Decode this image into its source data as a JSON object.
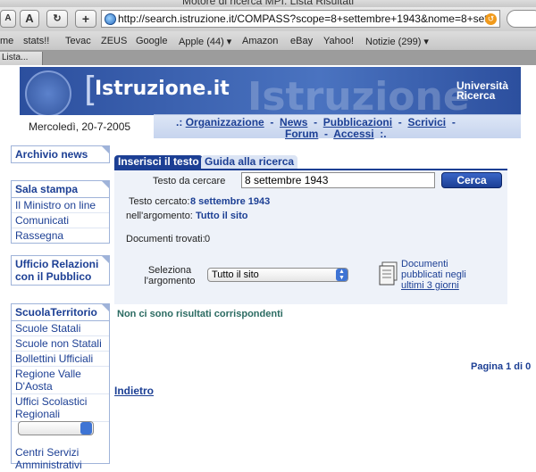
{
  "browser": {
    "window_title": "Motore di ricerca MPI: Lista Risultati",
    "url": "http://search.istruzione.it/COMPASS?scope=8+settembre+1943&nome=8+set",
    "bookmarks": [
      "me",
      "stats!!",
      "Tevac",
      "ZEUS",
      "Google",
      "Apple (44) ▾",
      "Amazon",
      "eBay",
      "Yahoo!",
      "Notizie (299) ▾"
    ],
    "tab_label": "Lista..."
  },
  "header": {
    "site_title": "Istruzione.it",
    "watermark": "Istruzione",
    "ministry_line1": "Università",
    "ministry_line2": "Ricerca",
    "date": "Mercoledì, 20-7-2005"
  },
  "nav": {
    "prefix": ".:",
    "items": [
      "Organizzazione",
      "News",
      "Pubblicazioni",
      "Scrivici",
      "Forum",
      "Accessi"
    ],
    "separator": "-",
    "suffix": ":."
  },
  "sidebar": {
    "archivio": "Archivio news",
    "sala_stampa": {
      "title": "Sala stampa",
      "items": [
        "Il Ministro on line",
        "Comunicati",
        "Rassegna"
      ]
    },
    "urp": "Ufficio Relazioni con il Pubblico",
    "scuola_territorio": {
      "title": "ScuolaTerritorio",
      "items": [
        "Scuole Statali",
        "Scuole non Statali",
        "Bollettini Ufficiali",
        "Regione Valle D'Aosta",
        "Uffici Scolastici Regionali"
      ],
      "after_select": "Centri Servizi Amministrativi"
    }
  },
  "search": {
    "tab_active": "Inserisci il testo",
    "tab_inactive": "Guida alla ricerca",
    "input_label": "Testo da cercare",
    "input_value": "8 settembre 1943",
    "button": "Cerca",
    "searched_label": "Testo cercato:",
    "searched_value": "8 settembre 1943",
    "argument_label": "nell'argomento:",
    "argument_value": "Tutto il sito",
    "found_label": "Documenti trovati:",
    "found_value": "0",
    "select_label": "Seleziona l'argomento",
    "select_value": "Tutto il sito",
    "recent_docs": "Documenti pubblicati negli",
    "recent_link": "ultimi 3 giorni"
  },
  "results": {
    "message": "Non ci sono risultati corrispondenti",
    "pagination": "Pagina 1 di 0",
    "back": "Indietro"
  }
}
